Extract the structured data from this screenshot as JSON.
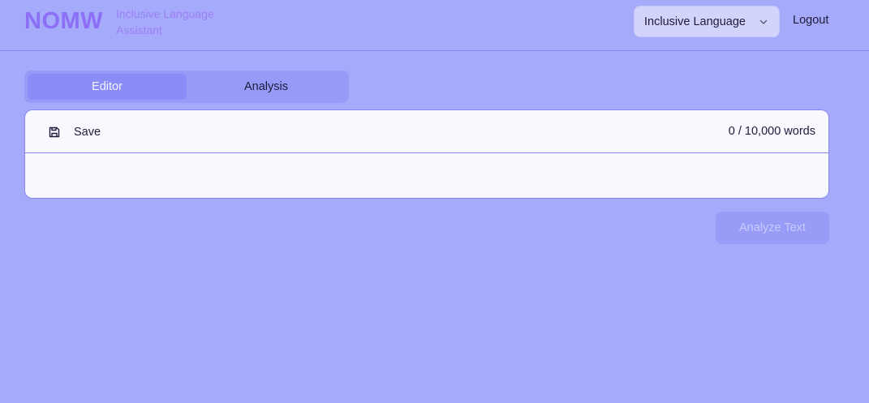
{
  "header": {
    "logo": "NOMW",
    "tagline_line1": "Inclusive Language",
    "tagline_line2": "Assistant",
    "language_select": {
      "selected": "Inclusive Language",
      "icon": "chevron-down-icon"
    },
    "logout_label": "Logout"
  },
  "tabs": [
    {
      "label": "Editor",
      "active": true
    },
    {
      "label": "Analysis",
      "active": false
    }
  ],
  "editor": {
    "save_label": "Save",
    "save_icon": "save-icon",
    "word_count": "0 / 10,000 words",
    "content": ""
  },
  "analyze_button": {
    "label": "Analyze Text",
    "disabled": true
  },
  "colors": {
    "background": "#a6aafb",
    "logo": "#8d6ef6",
    "tab_active": "#8a8df8",
    "card": "#f8f8ff",
    "border": "#8a86f0"
  }
}
